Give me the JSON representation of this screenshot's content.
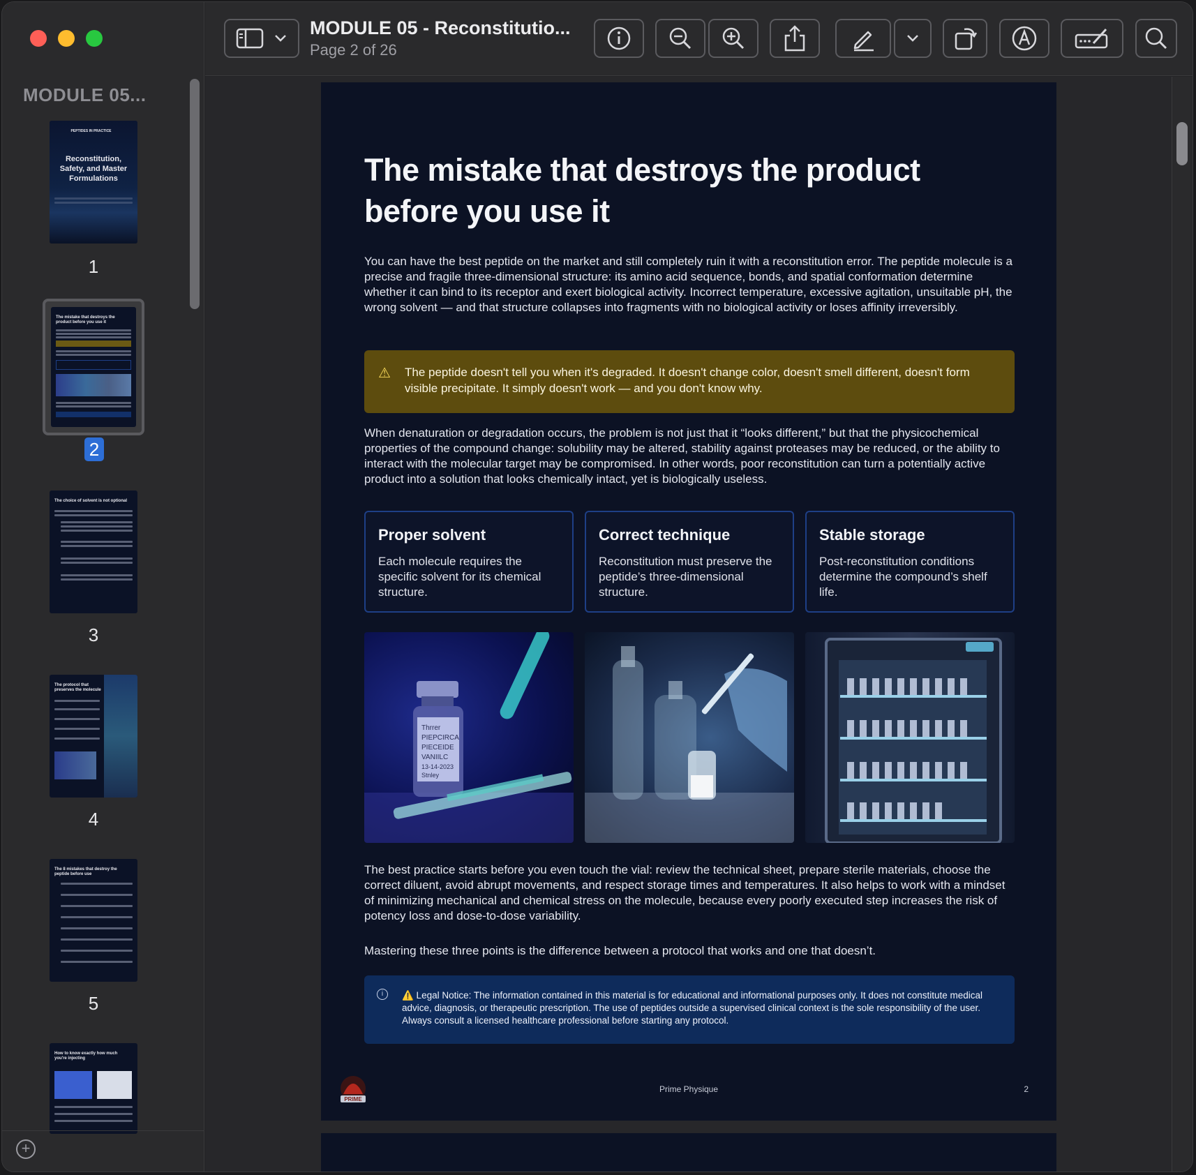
{
  "window": {
    "sidebar_title": "MODULE 05...",
    "doc_title": "MODULE 05 - Reconstitutio...",
    "doc_subtitle": "Page 2 of 26"
  },
  "thumbnails": [
    {
      "num": "1",
      "kicker": "PEPTIDES IN PRACTICE",
      "title": "Reconstitution, Safety, and Master Formulations"
    },
    {
      "num": "2",
      "title": "The mistake that destroys the product before you use it"
    },
    {
      "num": "3",
      "title": "The choice of solvent is not optional"
    },
    {
      "num": "4",
      "title": "The protocol that preserves the molecule"
    },
    {
      "num": "5",
      "title": "The 8 mistakes that destroy the peptide before use"
    },
    {
      "num": "6",
      "title": "How to know exactly how much you're injecting"
    }
  ],
  "page": {
    "heading": "The mistake that destroys the product before you use it",
    "para1": "You can have the best peptide on the market and still completely ruin it with a reconstitution error. The peptide molecule is a precise and fragile three-dimensional structure: its amino acid sequence, bonds, and spatial conformation determine whether it can bind to its receptor and exert biological activity. Incorrect temperature, excessive agitation, unsuitable pH, the wrong solvent — and that structure collapses into fragments with no biological activity or loses affinity irreversibly.",
    "warning": "The peptide doesn't tell you when it's degraded. It doesn't change color, doesn't smell different, doesn't form visible precipitate. It simply doesn't work — and you don't know why.",
    "para2": "When denaturation or degradation occurs, the problem is not just that it “looks different,” but that the physicochemical properties of the compound change: solubility may be altered, stability against proteases may be reduced, or the ability to interact with the molecular target may be compromised. In other words, poor reconstitution can turn a potentially active product into a solution that looks chemically intact, yet is biologically useless.",
    "cards": [
      {
        "title": "Proper solvent",
        "text": "Each molecule requires the specific solvent for its chemical structure."
      },
      {
        "title": "Correct technique",
        "text": "Reconstitution must preserve the peptide’s three-dimensional structure."
      },
      {
        "title": "Stable storage",
        "text": "Post-reconstitution conditions determine the compound’s shelf life."
      }
    ],
    "vial_label": "Thrrer PIEPCIRCA PIECEIDE VANIILC 13-14-2023 Stnley",
    "para3": "The best practice starts before you even touch the vial: review the technical sheet, prepare sterile materials, choose the correct diluent, avoid abrupt movements, and respect storage times and temperatures. It also helps to work with a mindset of minimizing mechanical and chemical stress on the molecule, because every poorly executed step increases the risk of potency loss and dose-to-dose variability.",
    "para4": "Mastering these three points is the difference between a protocol that works and one that doesn’t.",
    "legal": "⚠️ Legal Notice: The information contained in this material is for educational and informational purposes only. It does not constitute medical advice, diagnosis, or therapeutic prescription. The use of peptides outside a supervised clinical context is the sole responsibility of the user. Always consult a licensed healthcare professional before starting any protocol.",
    "footer_brand": "Prime Physique",
    "footer_page": "2",
    "logo_text": "PRIME"
  },
  "colors": {
    "accent_selected": "#2d6ed6",
    "warning_bg": "#5d4c0e",
    "legal_bg": "#0e2b5b",
    "card_border": "#1e3f86"
  }
}
